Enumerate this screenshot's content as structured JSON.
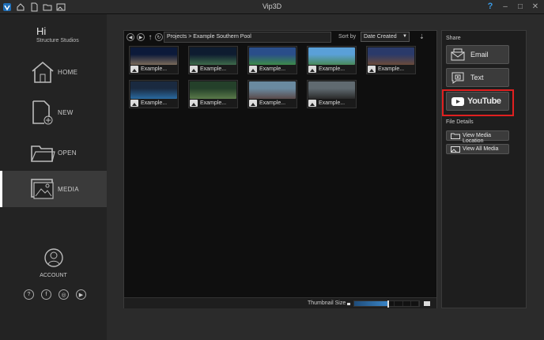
{
  "window": {
    "title": "Vip3D"
  },
  "sidebar": {
    "greeting": "Hi",
    "company": "Structure Studios",
    "items": [
      {
        "label": "HOME"
      },
      {
        "label": "NEW"
      },
      {
        "label": "OPEN"
      },
      {
        "label": "MEDIA"
      }
    ],
    "account_label": "ACCOUNT"
  },
  "toolbar": {
    "breadcrumb": "Projects  >  Example Southern Pool",
    "sort_label": "Sort by",
    "sort_value": "Date Created"
  },
  "media": {
    "items": [
      {
        "label": "Example...",
        "c1": "#0c1a3a",
        "c2": "#7a6a5a"
      },
      {
        "label": "Example...",
        "c1": "#0e1c30",
        "c2": "#3e6a4a"
      },
      {
        "label": "Example...",
        "c1": "#2a4e8a",
        "c2": "#3d8a4a"
      },
      {
        "label": "Example...",
        "c1": "#5aa0d8",
        "c2": "#4a8a5a"
      },
      {
        "label": "Example...",
        "c1": "#2a3a6a",
        "c2": "#6a4a3a"
      },
      {
        "label": "Example...",
        "c1": "#1a2a40",
        "c2": "#2a6aa0"
      },
      {
        "label": "Example...",
        "c1": "#24402a",
        "c2": "#5a7a4a"
      },
      {
        "label": "Example...",
        "c1": "#6a8aa0",
        "c2": "#5a4a4a"
      },
      {
        "label": "Example...",
        "c1": "#606a70",
        "c2": "#2a2a2a"
      }
    ]
  },
  "statusbar": {
    "thumbnail_size_label": "Thumbnail Size",
    "thumbnail_size_fraction": 0.52
  },
  "share": {
    "heading": "Share",
    "email_label": "Email",
    "text_label": "Text",
    "youtube_label": "YouTube"
  },
  "file_details": {
    "heading": "File Details",
    "view_location_label": "View Media Location",
    "view_all_label": "View All Media"
  },
  "colors": {
    "highlight": "#e02020",
    "accent": "#3a9be6"
  }
}
